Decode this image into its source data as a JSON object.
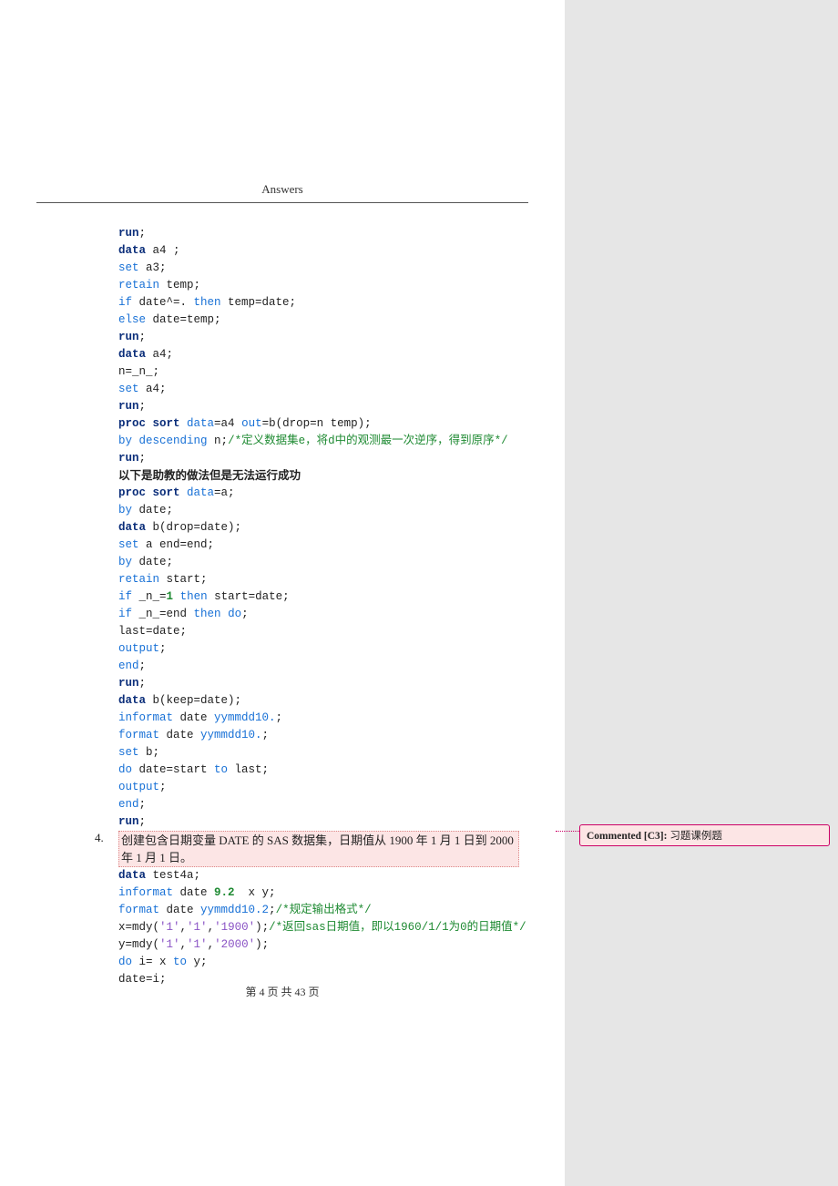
{
  "header": {
    "title": "Answers"
  },
  "code": {
    "p1": [
      [
        [
          "kw",
          "run"
        ],
        [
          "",
          ";"
        ]
      ],
      [
        [
          "kw",
          "data"
        ],
        [
          "",
          " a4 ;"
        ]
      ],
      [
        [
          "fn",
          "set"
        ],
        [
          "",
          " a3;"
        ]
      ],
      [
        [
          "fn",
          "retain"
        ],
        [
          "",
          " temp;"
        ]
      ],
      [
        [
          "fn",
          "if"
        ],
        [
          "",
          " date^=. "
        ],
        [
          "fn",
          "then"
        ],
        [
          "",
          " temp=date;"
        ]
      ],
      [
        [
          "fn",
          "else"
        ],
        [
          "",
          " date=temp;"
        ]
      ],
      [
        [
          "kw",
          "run"
        ],
        [
          "",
          ";"
        ]
      ],
      [
        [
          "kw",
          "data"
        ],
        [
          "",
          " a4;"
        ]
      ],
      [
        [
          "",
          "n=_n_;"
        ]
      ],
      [
        [
          "fn",
          "set"
        ],
        [
          "",
          " a4;"
        ]
      ],
      [
        [
          "kw",
          "run"
        ],
        [
          "",
          ";"
        ]
      ],
      [
        [
          "kw",
          "proc sort"
        ],
        [
          "",
          " "
        ],
        [
          "fn",
          "data"
        ],
        [
          "",
          "=a4 "
        ],
        [
          "fn",
          "out"
        ],
        [
          "",
          "=b(drop=n temp);"
        ]
      ],
      [
        [
          "fn",
          "by"
        ],
        [
          "",
          " "
        ],
        [
          "fn",
          "descending"
        ],
        [
          "",
          " n;"
        ],
        [
          "cmt",
          "/*定义数据集e，将d中的观测最一次逆序，得到原序*/"
        ]
      ],
      [
        [
          "kw",
          "run"
        ],
        [
          "",
          ";"
        ]
      ]
    ],
    "note1": "以下是助教的做法但是无法运行成功",
    "p2": [
      [
        [
          "kw",
          "proc sort"
        ],
        [
          "",
          " "
        ],
        [
          "fn",
          "data"
        ],
        [
          "",
          "=a;"
        ]
      ],
      [
        [
          "fn",
          "by"
        ],
        [
          "",
          " date;"
        ]
      ],
      [
        [
          "kw",
          "data"
        ],
        [
          "",
          " b(drop=date);"
        ]
      ],
      [
        [
          "fn",
          "set"
        ],
        [
          "",
          " a end=end;"
        ]
      ],
      [
        [
          "fn",
          "by"
        ],
        [
          "",
          " date;"
        ]
      ],
      [
        [
          "fn",
          "retain"
        ],
        [
          "",
          " start;"
        ]
      ],
      [
        [
          "fn",
          "if"
        ],
        [
          "",
          " _n_="
        ],
        [
          "num",
          "1"
        ],
        [
          "",
          " "
        ],
        [
          "fn",
          "then"
        ],
        [
          "",
          " start=date;"
        ]
      ],
      [
        [
          "fn",
          "if"
        ],
        [
          "",
          " _n_=end "
        ],
        [
          "fn",
          "then"
        ],
        [
          "",
          " "
        ],
        [
          "fn",
          "do"
        ],
        [
          "",
          ";"
        ]
      ],
      [
        [
          "",
          "last=date;"
        ]
      ],
      [
        [
          "fn",
          "output"
        ],
        [
          "",
          ";"
        ]
      ],
      [
        [
          "fn",
          "end"
        ],
        [
          "",
          ";"
        ]
      ],
      [
        [
          "kw",
          "run"
        ],
        [
          "",
          ";"
        ]
      ],
      [
        [
          "kw",
          "data"
        ],
        [
          "",
          " b(keep=date);"
        ]
      ],
      [
        [
          "fn",
          "informat"
        ],
        [
          "",
          " date "
        ],
        [
          "fn",
          "yymmdd10."
        ],
        [
          "",
          ";"
        ]
      ],
      [
        [
          "fn",
          "format"
        ],
        [
          "",
          " date "
        ],
        [
          "fn",
          "yymmdd10."
        ],
        [
          "",
          ";"
        ]
      ],
      [
        [
          "fn",
          "set"
        ],
        [
          "",
          " b;"
        ]
      ],
      [
        [
          "fn",
          "do"
        ],
        [
          "",
          " date=start "
        ],
        [
          "fn",
          "to"
        ],
        [
          "",
          " last;"
        ]
      ],
      [
        [
          "fn",
          "output"
        ],
        [
          "",
          ";"
        ]
      ],
      [
        [
          "fn",
          "end"
        ],
        [
          "",
          ";"
        ]
      ],
      [
        [
          "kw",
          "run"
        ],
        [
          "",
          ";"
        ]
      ]
    ],
    "p3": [
      [
        [
          "kw",
          "data"
        ],
        [
          "",
          " test4a;"
        ]
      ],
      [
        [
          "fn",
          "informat"
        ],
        [
          "",
          " date "
        ],
        [
          "num",
          "9.2"
        ],
        [
          "",
          "  x y;"
        ]
      ],
      [
        [
          "fn",
          "format"
        ],
        [
          "",
          " date "
        ],
        [
          "fn",
          "yymmdd10.2"
        ],
        [
          "",
          ";"
        ],
        [
          "cmt",
          "/*规定输出格式*/"
        ]
      ],
      [
        [
          "",
          "x=mdy("
        ],
        [
          "str",
          "'1'"
        ],
        [
          "",
          ","
        ],
        [
          "str",
          "'1'"
        ],
        [
          "",
          ","
        ],
        [
          "str",
          "'1900'"
        ],
        [
          "",
          ");"
        ],
        [
          "cmt",
          "/*返回sas日期值，即以1960/1/1为0的日期值*/"
        ]
      ],
      [
        [
          "",
          "y=mdy("
        ],
        [
          "str",
          "'1'"
        ],
        [
          "",
          ","
        ],
        [
          "str",
          "'1'"
        ],
        [
          "",
          ","
        ],
        [
          "str",
          "'2000'"
        ],
        [
          "",
          ");"
        ]
      ],
      [
        [
          "fn",
          "do"
        ],
        [
          "",
          " i= x "
        ],
        [
          "fn",
          "to"
        ],
        [
          "",
          " y;"
        ]
      ],
      [
        [
          "",
          "date=i;"
        ]
      ]
    ]
  },
  "question": {
    "num": "4.",
    "text": "创建包含日期变量 DATE 的 SAS 数据集，日期值从 1900 年 1 月 1 日到 2000 年 1 月 1 日。"
  },
  "footer": {
    "page_num": "第 4 页 共 43 页"
  },
  "comment": {
    "label": "Commented [C3]:",
    "text": "习题课例题"
  }
}
